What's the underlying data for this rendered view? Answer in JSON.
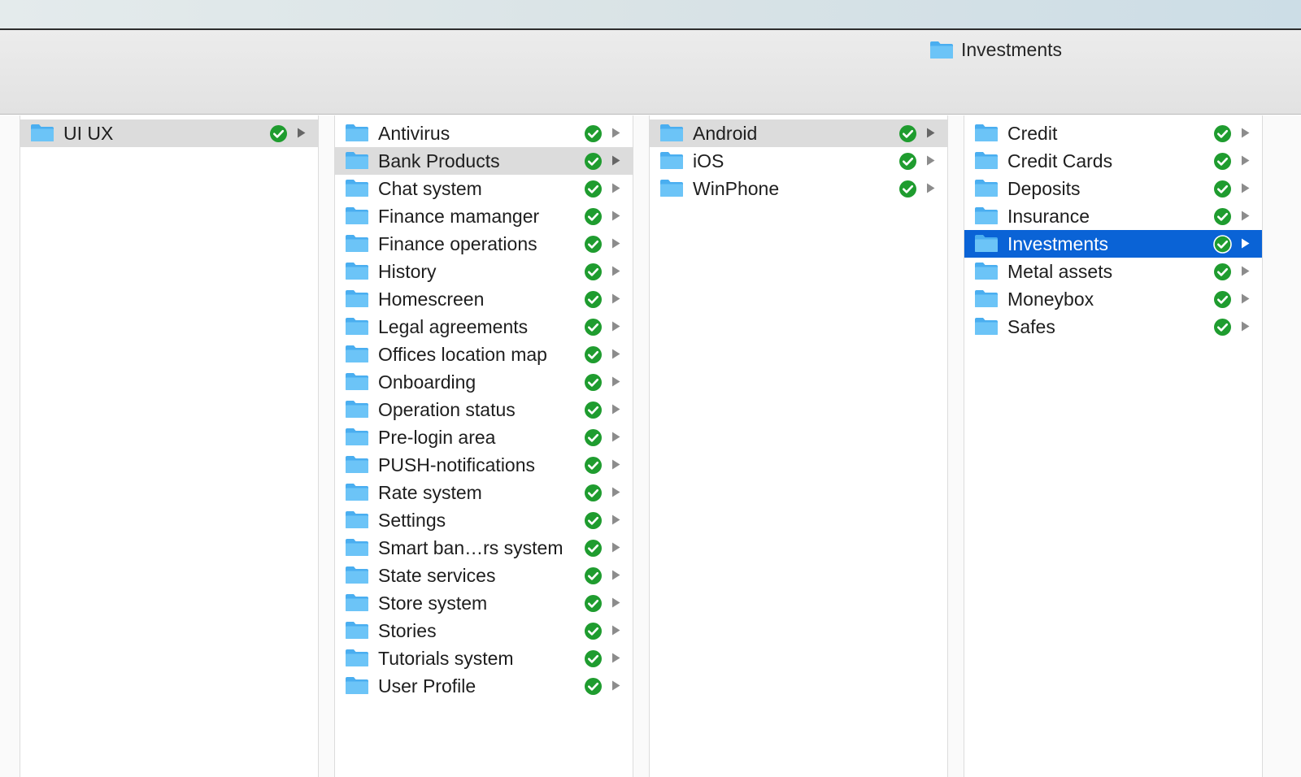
{
  "window": {
    "title": "Investments"
  },
  "columns": [
    {
      "items": [
        {
          "label": "UI UX",
          "selected": "gray"
        }
      ]
    },
    {
      "items": [
        {
          "label": "Antivirus"
        },
        {
          "label": "Bank Products",
          "selected": "gray"
        },
        {
          "label": "Chat system"
        },
        {
          "label": "Finance mamanger"
        },
        {
          "label": "Finance operations"
        },
        {
          "label": "History"
        },
        {
          "label": "Homescreen"
        },
        {
          "label": "Legal agreements"
        },
        {
          "label": "Offices location map"
        },
        {
          "label": "Onboarding"
        },
        {
          "label": "Operation status"
        },
        {
          "label": "Pre-login area"
        },
        {
          "label": "PUSH-notifications"
        },
        {
          "label": "Rate system"
        },
        {
          "label": "Settings"
        },
        {
          "label": "Smart ban…rs system"
        },
        {
          "label": "State services"
        },
        {
          "label": "Store system"
        },
        {
          "label": "Stories"
        },
        {
          "label": "Tutorials system"
        },
        {
          "label": "User Profile"
        }
      ]
    },
    {
      "items": [
        {
          "label": "Android",
          "selected": "gray"
        },
        {
          "label": "iOS"
        },
        {
          "label": "WinPhone"
        }
      ]
    },
    {
      "items": [
        {
          "label": "Credit"
        },
        {
          "label": "Credit Cards"
        },
        {
          "label": "Deposits"
        },
        {
          "label": "Insurance"
        },
        {
          "label": "Investments",
          "selected": "blue"
        },
        {
          "label": "Metal assets"
        },
        {
          "label": "Moneybox"
        },
        {
          "label": "Safes"
        }
      ]
    }
  ],
  "icons": {
    "folder": "folder-icon",
    "synced": "synced-check-icon",
    "disclosure": "disclosure-arrow-icon"
  },
  "colors": {
    "selection_blue": "#0a63d6",
    "selection_gray": "#dcdcdc",
    "check_green": "#1f9c2f",
    "folder_blue": "#6cc4f7"
  }
}
